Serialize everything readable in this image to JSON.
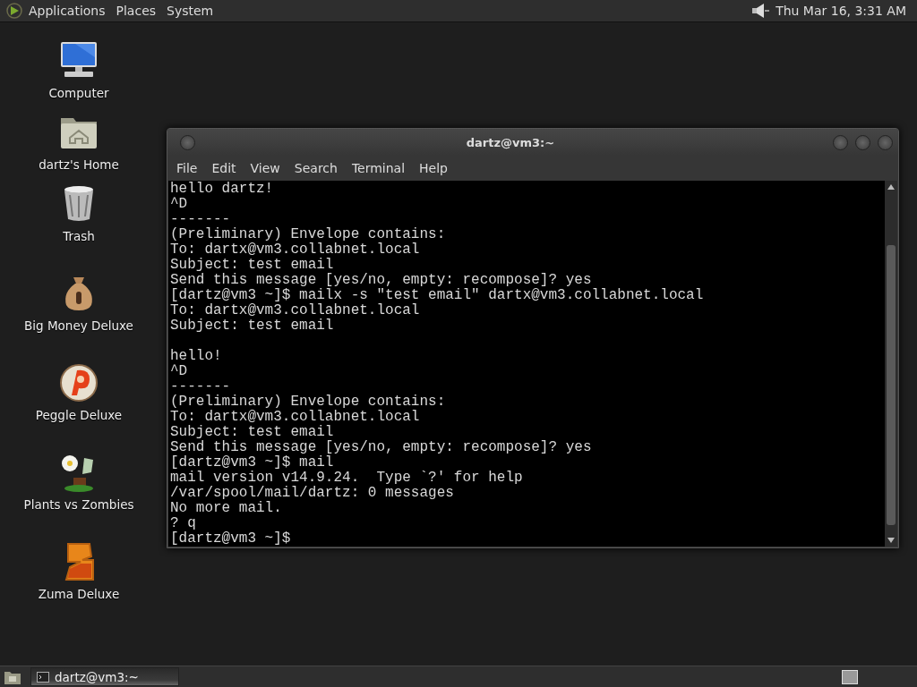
{
  "top_panel": {
    "menus": [
      "Applications",
      "Places",
      "System"
    ],
    "clock": "Thu Mar 16, 3:31 AM"
  },
  "desktop_icons": [
    {
      "label": "Computer",
      "kind": "computer"
    },
    {
      "label": "dartz's Home",
      "kind": "home"
    },
    {
      "label": "Trash",
      "kind": "trash"
    },
    {
      "label": "Big Money Deluxe",
      "kind": "moneybag"
    },
    {
      "label": "Peggle Deluxe",
      "kind": "ball"
    },
    {
      "label": "Plants vs Zombies",
      "kind": "plant"
    },
    {
      "label": "Zuma Deluxe",
      "kind": "stone"
    }
  ],
  "terminal": {
    "title": "dartz@vm3:~",
    "menu": [
      "File",
      "Edit",
      "View",
      "Search",
      "Terminal",
      "Help"
    ],
    "lines": [
      {
        "text": "hello dartz!"
      },
      {
        "text": "^D"
      },
      {
        "text": "-------"
      },
      {
        "text": "(Preliminary) Envelope contains:"
      },
      {
        "text": "To: dartx@vm3.collabnet.local"
      },
      {
        "text": "Subject: test email"
      },
      {
        "text": "Send this message [yes/no, empty: recompose]? yes"
      },
      {
        "text": "[dartz@vm3 ~]$ mailx -s \"test email\" dartx@vm3.collabnet.local"
      },
      {
        "text": "To: dartx@vm3.collabnet.local"
      },
      {
        "text": "Subject: test email"
      },
      {
        "kind": "blank"
      },
      {
        "text": "hello!"
      },
      {
        "text": "^D"
      },
      {
        "text": "-------"
      },
      {
        "text": "(Preliminary) Envelope contains:"
      },
      {
        "text": "To: dartx@vm3.collabnet.local"
      },
      {
        "text": "Subject: test email"
      },
      {
        "text": "Send this message [yes/no, empty: recompose]? yes"
      },
      {
        "text": "[dartz@vm3 ~]$ mail"
      },
      {
        "text": "mail version v14.9.24.  Type `?' for help"
      },
      {
        "text": "/var/spool/mail/dartz: 0 messages"
      },
      {
        "text": "No more mail."
      },
      {
        "text": "? q"
      },
      {
        "text": "[dartz@vm3 ~]$"
      }
    ]
  },
  "taskbar": {
    "windows": [
      {
        "title": "dartz@vm3:~",
        "selected": true
      }
    ]
  }
}
